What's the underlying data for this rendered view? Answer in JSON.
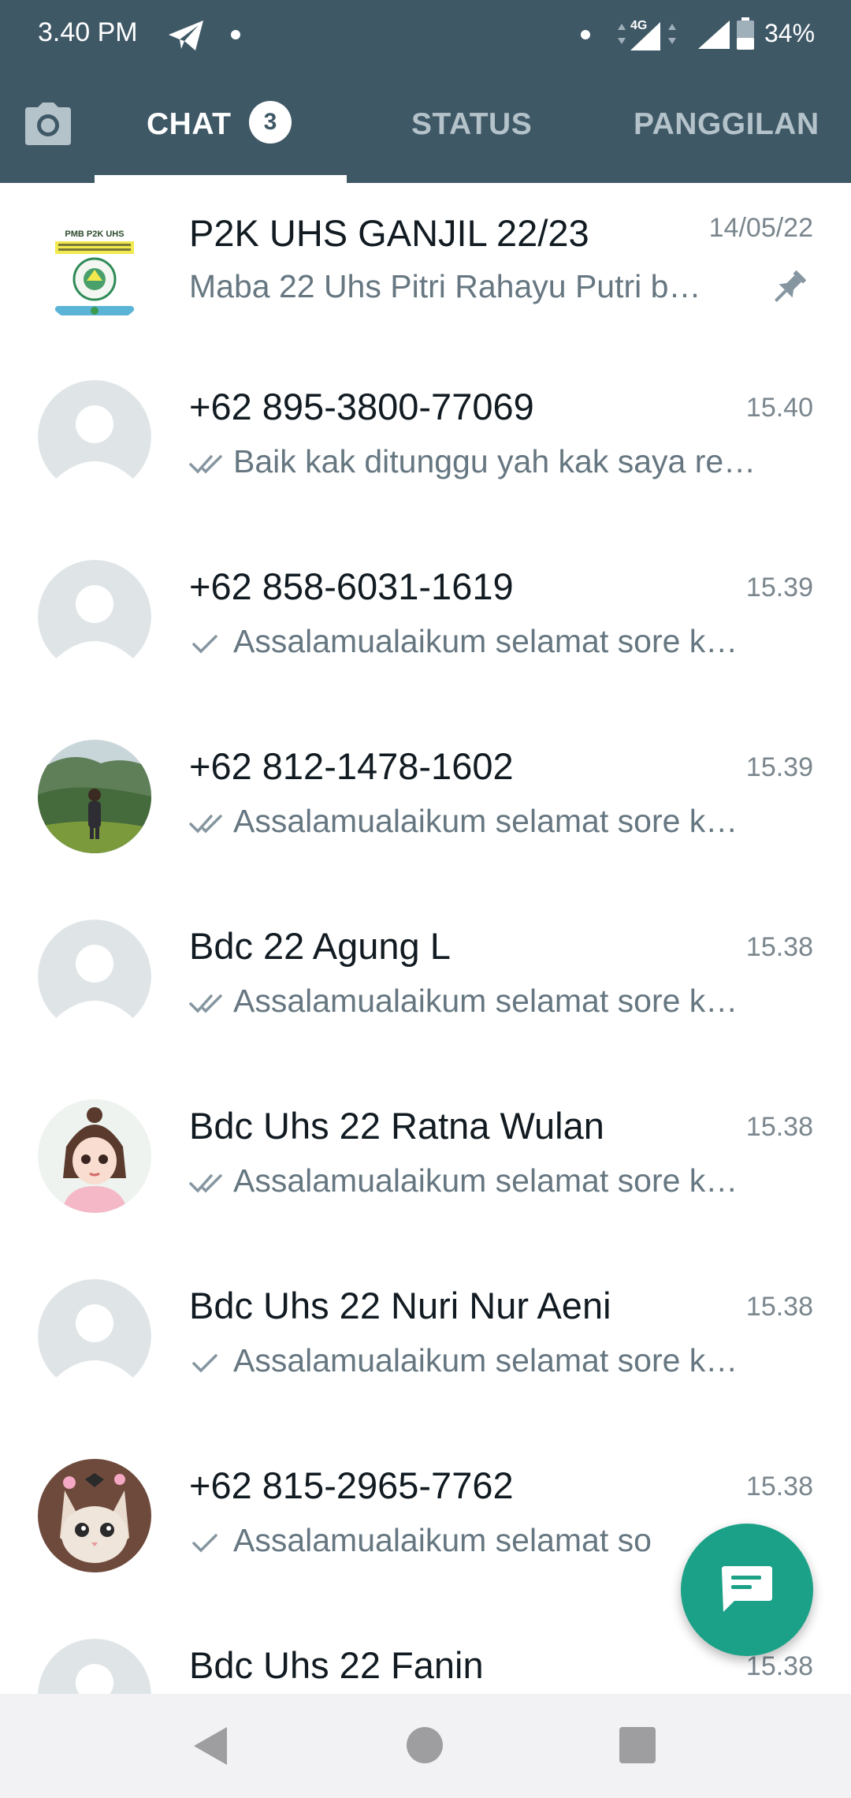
{
  "status_bar": {
    "time": "3.40 PM",
    "network": "4G",
    "battery": "34%",
    "icons": [
      "telegram-icon",
      "notification-dot-icon",
      "data-arrows-icon",
      "signal-icon",
      "battery-icon"
    ]
  },
  "tabs": {
    "camera_icon": "camera-icon",
    "chat_label": "CHAT",
    "chat_badge": "3",
    "status_label": "STATUS",
    "calls_label": "PANGGILAN",
    "active": "CHAT"
  },
  "chats": [
    {
      "name": "P2K UHS GANJIL 22/23",
      "time": "14/05/22",
      "preview": "Maba 22 Uhs Pitri Rahayu Putri b…",
      "tick": "none",
      "pinned": true,
      "avatar": "group-logo"
    },
    {
      "name": "+62 895-3800-77069",
      "time": "15.40",
      "preview": "Baik kak ditunggu yah kak saya re…",
      "tick": "double",
      "pinned": false,
      "avatar": "default"
    },
    {
      "name": "+62 858-6031-1619",
      "time": "15.39",
      "preview": "Assalamualaikum selamat sore  k…",
      "tick": "single",
      "pinned": false,
      "avatar": "default"
    },
    {
      "name": "+62 812-1478-1602",
      "time": "15.39",
      "preview": "Assalamualaikum selamat sore  k…",
      "tick": "double",
      "pinned": false,
      "avatar": "photo-landscape"
    },
    {
      "name": "Bdc 22 Agung L",
      "time": "15.38",
      "preview": "Assalamualaikum selamat sore  k…",
      "tick": "double",
      "pinned": false,
      "avatar": "default"
    },
    {
      "name": "Bdc Uhs 22 Ratna Wulan",
      "time": "15.38",
      "preview": "Assalamualaikum selamat sore  k…",
      "tick": "double",
      "pinned": false,
      "avatar": "photo-illustration"
    },
    {
      "name": "Bdc Uhs 22 Nuri Nur Aeni",
      "time": "15.38",
      "preview": "Assalamualaikum selamat sore  k…",
      "tick": "single",
      "pinned": false,
      "avatar": "default"
    },
    {
      "name": "+62 815-2965-7762",
      "time": "15.38",
      "preview": "Assalamualaikum selamat so",
      "tick": "single",
      "pinned": false,
      "avatar": "photo-cat"
    },
    {
      "name": "Bdc Uhs 22 Fanin",
      "time": "15.38",
      "preview": "",
      "tick": "none",
      "pinned": false,
      "avatar": "default"
    }
  ],
  "fab": {
    "icon": "new-chat-icon"
  },
  "nav_bar": {
    "icons": [
      "back-icon",
      "home-icon",
      "recents-icon"
    ]
  },
  "colors": {
    "header": "#3f5866",
    "accent": "#1aa187",
    "tab_inactive": "#b4c2ca",
    "text_primary": "#111b21",
    "text_secondary": "#667781"
  }
}
